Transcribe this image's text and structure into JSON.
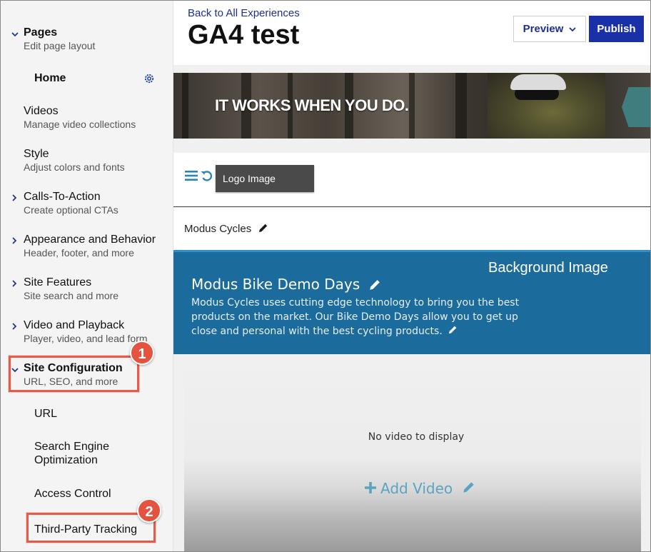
{
  "sidebar": {
    "pages": {
      "title": "Pages",
      "subtitle": "Edit page layout"
    },
    "home": {
      "label": "Home"
    },
    "videos": {
      "title": "Videos",
      "subtitle": "Manage video collections"
    },
    "style": {
      "title": "Style",
      "subtitle": "Adjust colors and fonts"
    },
    "ctas": {
      "title": "Calls-To-Action",
      "subtitle": "Create optional CTAs"
    },
    "appearance": {
      "title": "Appearance and Behavior",
      "subtitle": "Header, footer, and more"
    },
    "features": {
      "title": "Site Features",
      "subtitle": "Site search and more"
    },
    "playback": {
      "title": "Video and Playback",
      "subtitle": "Player, video, and lead form"
    },
    "siteconfig": {
      "title": "Site Configuration",
      "subtitle": "URL, SEO, and more"
    },
    "children": {
      "url": "URL",
      "seo": "Search Engine Optimization",
      "access": "Access Control",
      "tracking": "Third-Party Tracking"
    }
  },
  "callouts": {
    "one": "1",
    "two": "2"
  },
  "header": {
    "back_link": "Back to All Experiences",
    "title": "GA4 test",
    "preview_label": "Preview",
    "publish_label": "Publish"
  },
  "hero": {
    "text": "IT WORKS WHEN YOU DO."
  },
  "logo": {
    "tooltip": "Logo Image"
  },
  "site": {
    "name": "Modus Cycles"
  },
  "promo": {
    "background_label": "Background Image",
    "title": "Modus Bike Demo Days",
    "text": "Modus Cycles uses cutting edge technology to bring you the best products on the market. Our Bike Demo Days allow you to get up close and personal with the best cycling products."
  },
  "video": {
    "empty_text": "No video to display",
    "add_label": "Add Video"
  },
  "colors": {
    "accent": "#1930a8",
    "callout": "#e4533f",
    "section": "#1b6b9c"
  }
}
